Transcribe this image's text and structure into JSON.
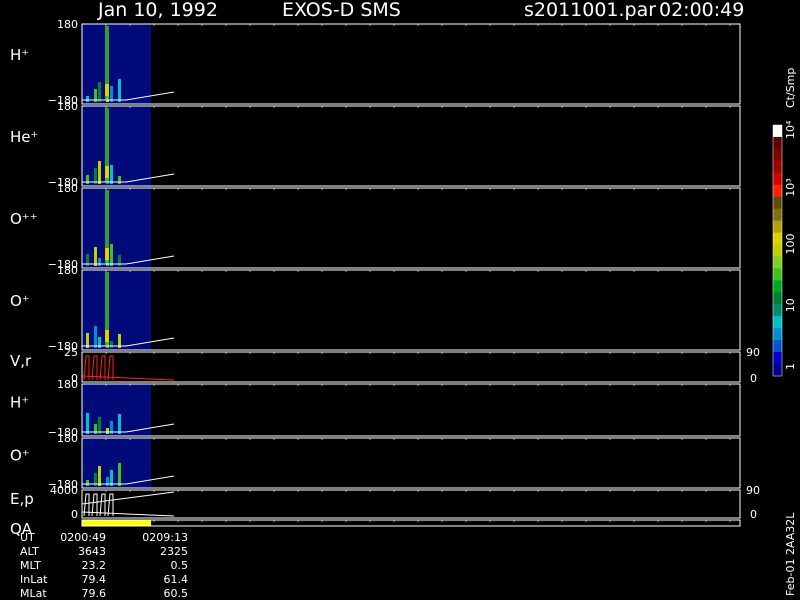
{
  "header": {
    "date": "Jan 10, 1992",
    "instrument": "EXOS-D SMS",
    "file": "s2011001.par",
    "time": "02:00:49"
  },
  "colorbar": {
    "unit": "Ct/Smp",
    "labels": [
      "1",
      "10",
      "100",
      "10³",
      "10⁴"
    ],
    "colors": [
      "#00008b",
      "#0000cd",
      "#0055d0",
      "#0090d0",
      "#00c0c8",
      "#009070",
      "#008030",
      "#00a820",
      "#40c020",
      "#80d020",
      "#c0d000",
      "#e0d000",
      "#b0a010",
      "#807010",
      "#604a10",
      "#ff2000",
      "#d00000",
      "#a00000",
      "#800000",
      "#600000",
      "#ffffff"
    ]
  },
  "side_text": "Feb-01  2AA32L",
  "footer": {
    "row_labels": [
      "UT",
      "ALT",
      "MLT",
      "InLat",
      "MLat"
    ],
    "col1": [
      "0200:49",
      "3643",
      "23.2",
      "79.4",
      "79.6"
    ],
    "col2": [
      "0209:13",
      "2325",
      "0.5",
      "61.4",
      "60.5"
    ]
  },
  "chart_data": [
    {
      "type": "heatmap",
      "label": "H⁺",
      "ylim": [
        -180,
        180
      ],
      "yticks": [
        "180",
        "−180"
      ],
      "data_x_range": [
        0,
        0.105
      ],
      "line_y": [
        -175,
        -155
      ]
    },
    {
      "type": "heatmap",
      "label": "He⁺",
      "ylim": [
        -180,
        180
      ],
      "yticks": [
        "180",
        "−180"
      ],
      "data_x_range": [
        0,
        0.105
      ],
      "line_y": [
        -175,
        -155
      ]
    },
    {
      "type": "heatmap",
      "label": "O⁺⁺",
      "ylim": [
        -180,
        180
      ],
      "yticks": [
        "180",
        "−180"
      ],
      "data_x_range": [
        0,
        0.105
      ],
      "line_y": [
        -175,
        -155
      ]
    },
    {
      "type": "heatmap",
      "label": "O⁺",
      "ylim": [
        -180,
        180
      ],
      "yticks": [
        "180",
        "−180"
      ],
      "data_x_range": [
        0,
        0.105
      ],
      "line_y": [
        -175,
        -155
      ]
    },
    {
      "type": "line",
      "label": "V,r",
      "ylim": [
        0,
        25
      ],
      "yticks": [
        "25",
        "0"
      ],
      "right_ticks": [
        "90",
        "0"
      ]
    },
    {
      "type": "heatmap",
      "label": "H⁺",
      "ylim": [
        -180,
        180
      ],
      "yticks": [
        "180",
        "−180"
      ],
      "data_x_range": [
        0,
        0.105
      ],
      "line_y": [
        -175,
        -155
      ]
    },
    {
      "type": "heatmap",
      "label": "O⁺",
      "ylim": [
        -180,
        180
      ],
      "yticks": [
        "180",
        "−180"
      ],
      "data_x_range": [
        0,
        0.105
      ],
      "line_y": [
        -175,
        -155
      ]
    },
    {
      "type": "line",
      "label": "E,p",
      "ylim": [
        0,
        4000
      ],
      "yticks": [
        "4000",
        "0"
      ],
      "right_ticks": [
        "90",
        "0"
      ]
    },
    {
      "type": "bar",
      "label": "QA",
      "data_x_range": [
        0,
        0.105
      ],
      "color": "#ffff00"
    }
  ]
}
